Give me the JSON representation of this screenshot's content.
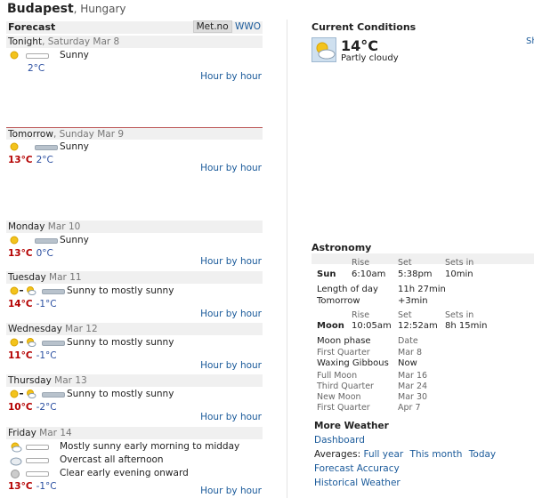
{
  "location": {
    "city": "Budapest",
    "country": ", Hungary"
  },
  "forecast": {
    "title": "Forecast",
    "sources": [
      "Met.no",
      "WWO"
    ],
    "hour_by_hour": "Hour by hour",
    "days": [
      {
        "name": "Tonight",
        "date": ", Saturday Mar 8",
        "conds": [
          {
            "icon": "sun-icon",
            "text": "Sunny"
          }
        ],
        "hi": "",
        "lo": "2°C"
      },
      {
        "name": "Tomorrow",
        "date": ", Sunday Mar 9",
        "conds": [
          {
            "icon": "sun-icon",
            "text": "Sunny"
          }
        ],
        "hi": "13°C",
        "lo": "2°C"
      },
      {
        "name": "Monday",
        "date": " Mar 10",
        "conds": [
          {
            "icon": "sun-icon",
            "text": "Sunny"
          }
        ],
        "hi": "13°C",
        "lo": "0°C"
      },
      {
        "name": "Tuesday",
        "date": " Mar 11",
        "conds": [
          {
            "icon": "sun-to-partly-cloudy-icon",
            "text": "Sunny to mostly sunny"
          }
        ],
        "hi": "14°C",
        "lo": "-1°C"
      },
      {
        "name": "Wednesday",
        "date": " Mar 12",
        "conds": [
          {
            "icon": "sun-to-partly-cloudy-icon",
            "text": "Sunny to mostly sunny"
          }
        ],
        "hi": "11°C",
        "lo": "-1°C"
      },
      {
        "name": "Thursday",
        "date": " Mar 13",
        "conds": [
          {
            "icon": "sun-to-partly-cloudy-icon",
            "text": "Sunny to mostly sunny"
          }
        ],
        "hi": "10°C",
        "lo": "-2°C"
      },
      {
        "name": "Friday",
        "date": " Mar 14",
        "conds": [
          {
            "icon": "partly-cloudy-icon",
            "text": "Mostly sunny early morning to midday"
          },
          {
            "icon": "cloudy-icon",
            "text": "Overcast all afternoon"
          },
          {
            "icon": "moon-icon",
            "text": "Clear early evening onward"
          }
        ],
        "hi": "13°C",
        "lo": "-1°C"
      }
    ]
  },
  "current": {
    "title": "Current Conditions",
    "temp": "14°C",
    "desc": "Partly cloudy",
    "icon": "partly-cloudy-icon",
    "side": "Sh"
  },
  "astronomy": {
    "title": "Astronomy",
    "col_rise": "Rise",
    "col_set": "Set",
    "col_setsin": "Sets in",
    "sun": {
      "label": "Sun",
      "rise": "6:10am",
      "set": "5:38pm",
      "sets_in": "10min"
    },
    "length_label": "Length of day",
    "length": "11h 27min",
    "tomorrow_label": "Tomorrow",
    "tomorrow": "+3min",
    "moon": {
      "label": "Moon",
      "rise": "10:05am",
      "set": "12:52am",
      "sets_in": "8h 15min"
    },
    "phase_label": "Moon phase",
    "date_label": "Date",
    "phases": [
      {
        "name": "First Quarter",
        "date": "Mar 8"
      },
      {
        "name": "Waxing Gibbous",
        "date": "Now"
      },
      {
        "name": "Full Moon",
        "date": "Mar 16"
      },
      {
        "name": "Third Quarter",
        "date": "Mar 24"
      },
      {
        "name": "New Moon",
        "date": "Mar 30"
      },
      {
        "name": "First Quarter",
        "date": "Apr 7"
      }
    ]
  },
  "more": {
    "title": "More Weather",
    "dashboard": "Dashboard",
    "averages_label": "Averages:",
    "full_year": "Full year",
    "this_month": "This month",
    "today": "Today",
    "accuracy": "Forecast Accuracy",
    "historical": "Historical Weather"
  }
}
